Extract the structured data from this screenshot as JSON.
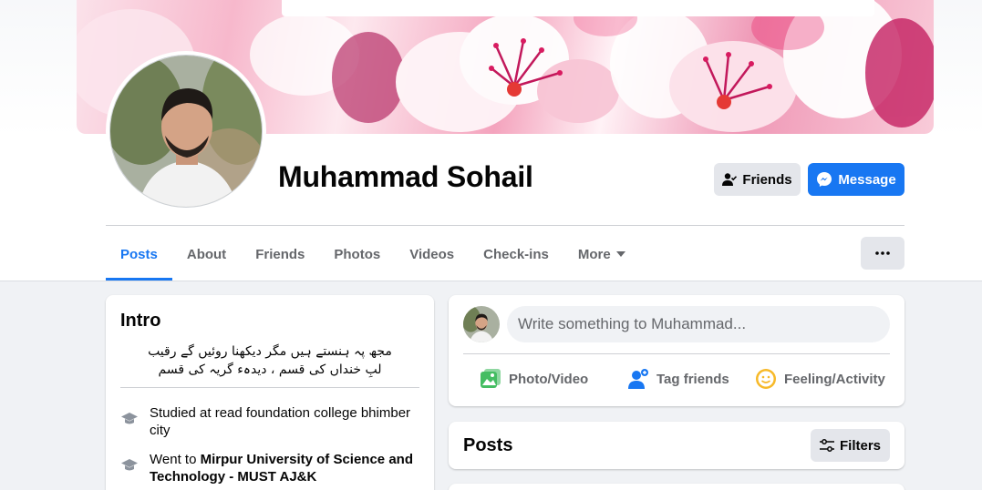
{
  "profile": {
    "name": "Muhammad Sohail",
    "friends_button": "Friends",
    "message_button": "Message",
    "avatar_icon": "profile-photo",
    "cover_icon": "cover-photo-pink-blossoms"
  },
  "nav": {
    "tabs": [
      {
        "label": "Posts",
        "active": true
      },
      {
        "label": "About"
      },
      {
        "label": "Friends"
      },
      {
        "label": "Photos"
      },
      {
        "label": "Videos"
      },
      {
        "label": "Check-ins"
      },
      {
        "label": "More"
      }
    ],
    "more_icon": "caret-down-icon",
    "options_icon": "ellipsis-icon"
  },
  "intro": {
    "title": "Intro",
    "bio_lines": [
      "مجھ پہ ہنستے ہیں مگر دیکھنا روئیں گے رقیب",
      "لبِ خنداں کی قسم ، دیدہء گریہ کی قسم"
    ],
    "education": [
      {
        "prefix": "Studied at read foundation college bhimber city",
        "bold": ""
      },
      {
        "prefix": "Went to ",
        "bold": "Mirpur University of Science and Technology - MUST AJ&K"
      }
    ]
  },
  "composer": {
    "placeholder": "Write something to Muhammad...",
    "actions": [
      {
        "label": "Photo/Video",
        "icon": "photo-icon"
      },
      {
        "label": "Tag friends",
        "icon": "tag-friends-icon"
      },
      {
        "label": "Feeling/Activity",
        "icon": "feeling-icon"
      }
    ]
  },
  "posts": {
    "title": "Posts",
    "filters_button": "Filters"
  },
  "colors": {
    "accent": "#1877f2",
    "background": "#f0f2f5",
    "secondary_text": "#65676b",
    "button_gray": "#e4e6eb"
  }
}
